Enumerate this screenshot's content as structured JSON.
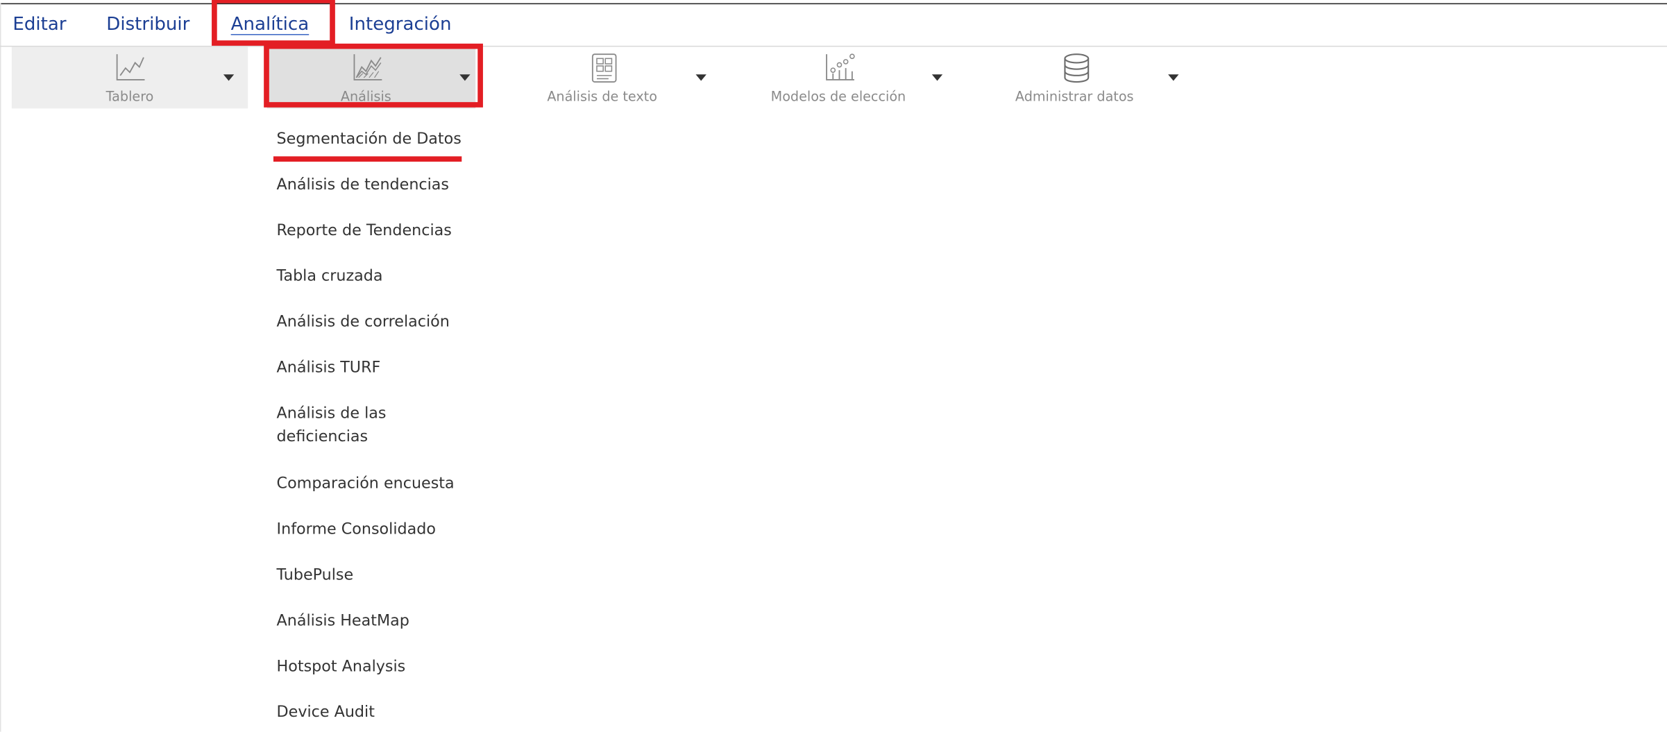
{
  "nav": {
    "tabs": [
      {
        "label": "Editar"
      },
      {
        "label": "Distribuir"
      },
      {
        "label": "Analítica",
        "active": true
      },
      {
        "label": "Integración"
      }
    ]
  },
  "toolbar": {
    "tools": [
      {
        "label": "Tablero",
        "icon": "line-chart-icon"
      },
      {
        "label": "Análisis",
        "icon": "area-chart-icon",
        "selected": true
      },
      {
        "label": "Análisis de texto",
        "icon": "text-document-icon"
      },
      {
        "label": "Modelos de elección",
        "icon": "scatter-bar-icon"
      },
      {
        "label": "Administrar datos",
        "icon": "database-icon"
      }
    ]
  },
  "menu": {
    "items": [
      {
        "label": "Segmentación de Datos"
      },
      {
        "label": "Análisis de tendencias"
      },
      {
        "label": "Reporte de Tendencias"
      },
      {
        "label": "Tabla cruzada"
      },
      {
        "label": "Análisis de correlación"
      },
      {
        "label": "Análisis TURF"
      },
      {
        "label": "Análisis de las deficiencias"
      },
      {
        "label": "Comparación encuesta"
      },
      {
        "label": "Informe Consolidado"
      },
      {
        "label": "TubePulse"
      },
      {
        "label": "Análisis HeatMap"
      },
      {
        "label": "Hotspot Analysis"
      },
      {
        "label": "Device Audit"
      }
    ]
  },
  "colors": {
    "nav_text": "#1c3f94",
    "highlight": "#e31e24",
    "label_gray": "#8a8a8a"
  }
}
